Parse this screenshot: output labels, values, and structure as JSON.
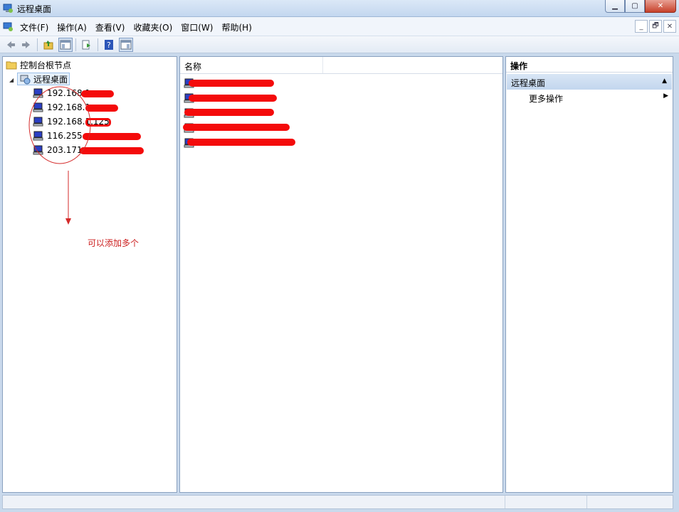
{
  "window": {
    "title": "远程桌面",
    "buttons": {
      "minimize": "▁",
      "maximize": "▢",
      "close": "✕"
    }
  },
  "menu": {
    "items": [
      "文件(F)",
      "操作(A)",
      "查看(V)",
      "收藏夹(O)",
      "窗口(W)",
      "帮助(H)"
    ],
    "mdi": {
      "minimize": "_",
      "restore": "🗗",
      "close": "✕"
    }
  },
  "toolbar": {
    "icons": [
      "back-arrow-icon",
      "forward-arrow-icon",
      "up-folder-icon",
      "show-hide-tree-icon",
      "export-list-icon",
      "help-icon",
      "show-hide-action-pane-icon"
    ]
  },
  "tree": {
    "root": "控制台根节点",
    "node": "远程桌面",
    "children": [
      "192.168.1",
      "192.168.1",
      "192.168.1.125",
      "116.255.",
      "203.171"
    ]
  },
  "list": {
    "column_name": "名称",
    "row_count": 5
  },
  "actions": {
    "title": "操作",
    "group": "远程桌面",
    "item": "更多操作"
  },
  "annotation": {
    "text": "可以添加多个",
    "color": "#cc2020"
  },
  "colors": {
    "redaction": "#f40b0b",
    "accent": "#c2d6ee"
  }
}
